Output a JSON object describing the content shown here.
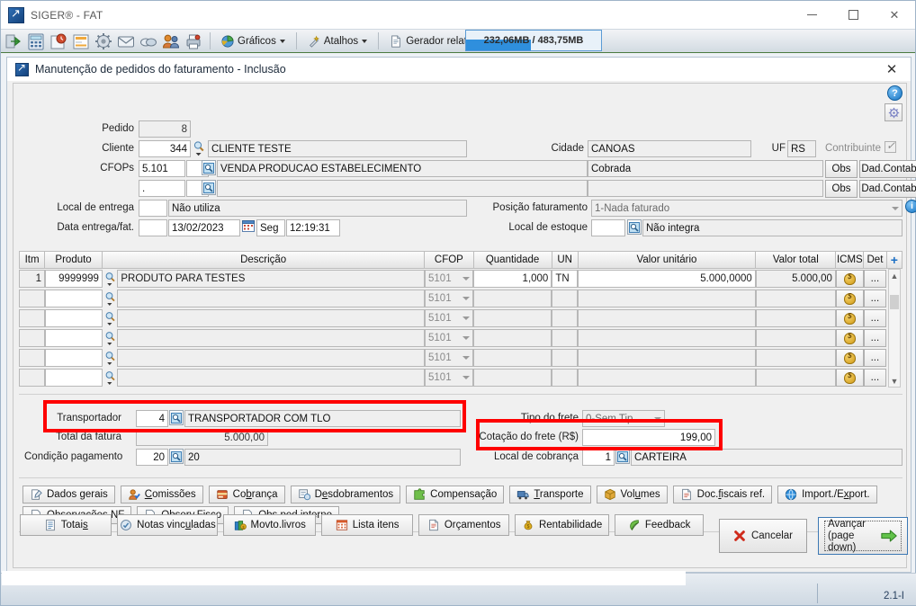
{
  "window": {
    "title": "SIGER® - FAT",
    "icon": "app-icon",
    "minimize": "–",
    "maximize": "□",
    "close": "✕"
  },
  "toolbar": {
    "icons": [
      {
        "name": "login-exit-icon",
        "glyph": "⇥"
      },
      {
        "name": "calculator-icon",
        "glyph": "▦"
      },
      {
        "name": "schedule-clock-icon",
        "glyph": "◷"
      },
      {
        "name": "list-report-icon",
        "glyph": "▤"
      },
      {
        "name": "gear-settings-icon",
        "glyph": "⚙"
      },
      {
        "name": "mail-icon",
        "glyph": "✉"
      },
      {
        "name": "book-icon",
        "glyph": "◍"
      },
      {
        "name": "users-icon",
        "glyph": "👥"
      },
      {
        "name": "printer-icon",
        "glyph": "🖶"
      }
    ],
    "menus": [
      {
        "name": "graficos-menu",
        "label": "Gráficos",
        "icon": "pie-chart-icon"
      },
      {
        "name": "atalhos-menu",
        "label": "Atalhos",
        "icon": "magic-wand-icon"
      },
      {
        "name": "gerador-menu",
        "label": "Gerador relat/gráf",
        "icon": "document-icon"
      }
    ],
    "memory": {
      "label": "232,06MB / 483,75MB",
      "used_mb": 232.06,
      "total_mb": 483.75,
      "percent": 48
    }
  },
  "dialog": {
    "title": "Manutenção de pedidos do faturamento - Inclusão",
    "close": "✕",
    "help_icon": "?"
  },
  "form": {
    "pedido": {
      "label": "Pedido",
      "value": "8"
    },
    "cliente": {
      "label": "Cliente",
      "code": "344",
      "name": "CLIENTE TESTE"
    },
    "cfops": {
      "label": "CFOPs",
      "row1": {
        "code": "5.101",
        "code2": "",
        "desc": "VENDA PRODUCAO ESTABELECIMENTO"
      },
      "row2": {
        "code": ".",
        "code2": "",
        "desc": ""
      }
    },
    "local_entrega": {
      "label": "Local de entrega",
      "code": "",
      "desc": "Não utiliza"
    },
    "data_entrega": {
      "label": "Data entrega/fat.",
      "code": "",
      "date": "13/02/2023",
      "weekday": "Seg",
      "time": "12:19:31"
    },
    "cidade": {
      "label": "Cidade",
      "value": "CANOAS"
    },
    "uf": {
      "label": "UF",
      "value": "RS"
    },
    "contribuinte": {
      "label": "Contribuinte",
      "checked": true
    },
    "cobranca_row1": {
      "value": "Cobrada",
      "obs": "Obs",
      "dad_contab": "Dad.Contab"
    },
    "cobranca_row2": {
      "value": "",
      "obs": "Obs",
      "dad_contab": "Dad.Contab"
    },
    "posicao_faturamento": {
      "label": "Posição faturamento",
      "value": "1-Nada faturado"
    },
    "local_estoque": {
      "label": "Local de estoque",
      "code": "",
      "desc": "Não integra"
    }
  },
  "grid": {
    "columns": [
      {
        "key": "itm",
        "label": "Itm"
      },
      {
        "key": "produto",
        "label": "Produto"
      },
      {
        "key": "descricao",
        "label": "Descrição"
      },
      {
        "key": "cfop",
        "label": "CFOP"
      },
      {
        "key": "quantidade",
        "label": "Quantidade"
      },
      {
        "key": "un",
        "label": "UN"
      },
      {
        "key": "valor_unitario",
        "label": "Valor unitário"
      },
      {
        "key": "valor_total",
        "label": "Valor total"
      },
      {
        "key": "icms",
        "label": "ICMS"
      },
      {
        "key": "det",
        "label": "Det"
      },
      {
        "key": "add",
        "label": "+"
      }
    ],
    "rows": [
      {
        "itm": "1",
        "produto": "9999999",
        "descricao": "PRODUTO PARA TESTES",
        "cfop": "5101",
        "quantidade": "1,000",
        "un": "TN",
        "valor_unitario": "5.000,0000",
        "valor_total": "5.000,00",
        "det": "...",
        "filled": true
      },
      {
        "itm": "",
        "produto": "",
        "descricao": "",
        "cfop": "5101",
        "quantidade": "",
        "un": "",
        "valor_unitario": "",
        "valor_total": "",
        "det": "...",
        "filled": false
      },
      {
        "itm": "",
        "produto": "",
        "descricao": "",
        "cfop": "5101",
        "quantidade": "",
        "un": "",
        "valor_unitario": "",
        "valor_total": "",
        "det": "...",
        "filled": false
      },
      {
        "itm": "",
        "produto": "",
        "descricao": "",
        "cfop": "5101",
        "quantidade": "",
        "un": "",
        "valor_unitario": "",
        "valor_total": "",
        "det": "...",
        "filled": false
      },
      {
        "itm": "",
        "produto": "",
        "descricao": "",
        "cfop": "5101",
        "quantidade": "",
        "un": "",
        "valor_unitario": "",
        "valor_total": "",
        "det": "...",
        "filled": false
      },
      {
        "itm": "",
        "produto": "",
        "descricao": "",
        "cfop": "5101",
        "quantidade": "",
        "un": "",
        "valor_unitario": "",
        "valor_total": "",
        "det": "...",
        "filled": false
      }
    ]
  },
  "totals": {
    "transportador": {
      "label": "Transportador",
      "code": "4",
      "name": "TRANSPORTADOR COM TLO",
      "highlighted": true
    },
    "total_fatura": {
      "label": "Total da fatura",
      "value": "5.000,00"
    },
    "condicao_pagamento": {
      "label": "Condição pagamento",
      "code": "20",
      "desc": "20"
    },
    "tipo_frete": {
      "label": "Tipo do frete",
      "value": "0-Sem Tip"
    },
    "cotacao_frete": {
      "label": "Cotação do frete (R$)",
      "value": "199,00",
      "highlighted": true
    },
    "local_cobranca": {
      "label": "Local de cobrança",
      "code": "1",
      "desc": "CARTEIRA"
    }
  },
  "tabs_row1": [
    {
      "name": "tab-dados-gerais",
      "label": "Dados gerais",
      "accel": "g",
      "icon": "edit-note-icon"
    },
    {
      "name": "tab-comissoes",
      "label": "Comissões",
      "accel": "C",
      "icon": "user-check-icon"
    },
    {
      "name": "tab-cobranca",
      "label": "Cobrança",
      "accel": "b",
      "icon": "card-icon"
    },
    {
      "name": "tab-desdobramentos",
      "label": "Desdobramentos",
      "accel": "e",
      "icon": "split-icon"
    },
    {
      "name": "tab-compensacao",
      "label": "Compensação",
      "accel": "",
      "icon": "puzzle-icon"
    },
    {
      "name": "tab-transporte",
      "label": "Transporte",
      "accel": "T",
      "icon": "truck-icon"
    },
    {
      "name": "tab-volumes",
      "label": "Volumes",
      "accel": "u",
      "icon": "box-icon"
    },
    {
      "name": "tab-doc-fiscais-ref",
      "label": "Doc.fiscais ref.",
      "accel": "f",
      "icon": "document-icon"
    },
    {
      "name": "tab-import-export",
      "label": "Import./Export.",
      "accel": "x",
      "icon": "globe-icon"
    }
  ],
  "tabs_row2": [
    {
      "name": "tab-observacoes-nf",
      "label": "Observações NF",
      "accel": "",
      "icon": "note-icon"
    },
    {
      "name": "tab-observ-fisco",
      "label": "Observ.Fisco",
      "accel": "v",
      "icon": "note-icon"
    },
    {
      "name": "tab-obs-ped-interno",
      "label": "Obs.ped.interno",
      "accel": "p",
      "icon": "note-icon"
    }
  ],
  "bottom_buttons": [
    {
      "name": "btn-totais",
      "label": "Totais",
      "accel": "s",
      "icon": "list-icon"
    },
    {
      "name": "btn-notas-vinculadas",
      "label": "Notas vinculadas",
      "accel": "u",
      "icon": "link-notes-icon"
    },
    {
      "name": "btn-movto-livros",
      "label": "Movto.livros",
      "accel": "",
      "icon": "books-money-icon"
    },
    {
      "name": "btn-lista-itens",
      "label": "Lista itens",
      "accel": "",
      "icon": "calendar-grid-icon"
    },
    {
      "name": "btn-orcamentos",
      "label": "Orçamentos",
      "accel": "",
      "icon": "document-icon"
    },
    {
      "name": "btn-rentabilidade",
      "label": "Rentabilidade",
      "accel": "",
      "icon": "money-bag-icon"
    },
    {
      "name": "btn-feedback",
      "label": "Feedback",
      "accel": "",
      "icon": "leaf-icon"
    }
  ],
  "actions": {
    "cancel": {
      "label": "Cancelar",
      "icon": "red-x-icon"
    },
    "advance_line1": "Avançar",
    "advance_line2": "(page down)",
    "advance_icon": "green-arrow-icon"
  },
  "status": {
    "version": "2.1-I"
  },
  "colors": {
    "highlight_red": "#fe0000",
    "accent_blue": "#2f8fdd",
    "toolbar_green_border": "#4a7a3f"
  }
}
